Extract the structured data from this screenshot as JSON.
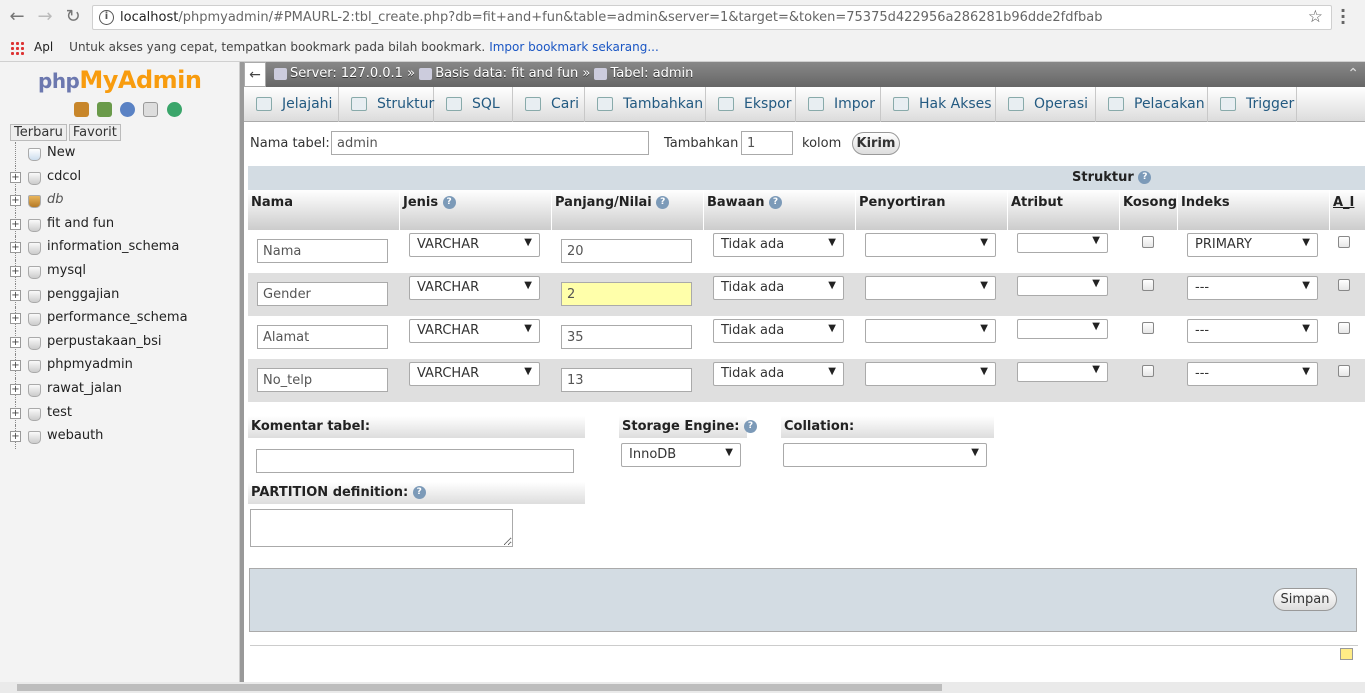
{
  "browser": {
    "url_host": "localhost",
    "url_rest": "/phpmyadmin/#PMAURL-2:tbl_create.php?db=fit+and+fun&table=admin&server=1&target=&token=75375d422956a286281b96dde2fdfbab",
    "bookmarks_apps_label": "Apl",
    "bookmarks_hint": "Untuk akses yang cepat, tempatkan bookmark pada bilah bookmark.",
    "bookmarks_import_link": "Impor bookmark sekarang..."
  },
  "sidebar": {
    "logo_php": "php",
    "logo_myadmin": "MyAdmin",
    "tab_recent": "Terbaru",
    "tab_favorites": "Favorit",
    "tree": [
      {
        "label": "New",
        "italic": false
      },
      {
        "label": "cdcol",
        "italic": false
      },
      {
        "label": "db",
        "italic": true
      },
      {
        "label": "fit and fun",
        "italic": false
      },
      {
        "label": "information_schema",
        "italic": false
      },
      {
        "label": "mysql",
        "italic": false
      },
      {
        "label": "penggajian",
        "italic": false
      },
      {
        "label": "performance_schema",
        "italic": false
      },
      {
        "label": "perpustakaan_bsi",
        "italic": false
      },
      {
        "label": "phpmyadmin",
        "italic": false
      },
      {
        "label": "rawat_jalan",
        "italic": false
      },
      {
        "label": "test",
        "italic": false
      },
      {
        "label": "webauth",
        "italic": false
      }
    ]
  },
  "topbar": {
    "server": "Server: 127.0.0.1",
    "database": "Basis data: fit and fun",
    "table": "Tabel: admin",
    "separator": "»"
  },
  "tabs": [
    {
      "label": "Jelajahi",
      "icon": "browse-icon"
    },
    {
      "label": "Struktur",
      "icon": "structure-icon"
    },
    {
      "label": "SQL",
      "icon": "sql-icon"
    },
    {
      "label": "Cari",
      "icon": "search-icon"
    },
    {
      "label": "Tambahkan",
      "icon": "insert-icon"
    },
    {
      "label": "Ekspor",
      "icon": "export-icon"
    },
    {
      "label": "Impor",
      "icon": "import-icon"
    },
    {
      "label": "Hak Akses",
      "icon": "privileges-icon"
    },
    {
      "label": "Operasi",
      "icon": "wrench-icon"
    },
    {
      "label": "Pelacakan",
      "icon": "eye-icon"
    },
    {
      "label": "Trigger",
      "icon": "trigger-icon"
    }
  ],
  "form": {
    "table_name_label": "Nama tabel:",
    "table_name_value": "admin",
    "add_label": "Tambahkan",
    "add_count": "1",
    "columns_label": "kolom",
    "submit_label": "Kirim"
  },
  "structure": {
    "title": "Struktur",
    "headers": {
      "name": "Nama",
      "type": "Jenis",
      "length": "Panjang/Nilai",
      "default": "Bawaan",
      "collation": "Penyortiran",
      "attributes": "Atribut",
      "null": "Kosong",
      "index": "Indeks",
      "ai": "A_I"
    },
    "rows": [
      {
        "name": "Nama",
        "type": "VARCHAR",
        "length": "20",
        "default": "Tidak ada",
        "collation": "",
        "attribute": "",
        "index": "PRIMARY",
        "highlight": false
      },
      {
        "name": "Gender",
        "type": "VARCHAR",
        "length": "2",
        "default": "Tidak ada",
        "collation": "",
        "attribute": "",
        "index": "---",
        "highlight": true
      },
      {
        "name": "Alamat",
        "type": "VARCHAR",
        "length": "35",
        "default": "Tidak ada",
        "collation": "",
        "attribute": "",
        "index": "---",
        "highlight": false
      },
      {
        "name": "No_telp",
        "type": "VARCHAR",
        "length": "13",
        "default": "Tidak ada",
        "collation": "",
        "attribute": "",
        "index": "---",
        "highlight": false
      }
    ]
  },
  "bottom": {
    "comment_label": "Komentar tabel:",
    "storage_label": "Storage Engine:",
    "storage_value": "InnoDB",
    "collation_label": "Collation:",
    "collation_value": "",
    "partition_label": "PARTITION definition:",
    "save_label": "Simpan"
  },
  "colors": {
    "link": "#235a81",
    "header_bg": "#d3dce3",
    "highlight_input": "#ffffaa",
    "logo_accent": "#f89c0e",
    "logo_php": "#6c78af"
  }
}
